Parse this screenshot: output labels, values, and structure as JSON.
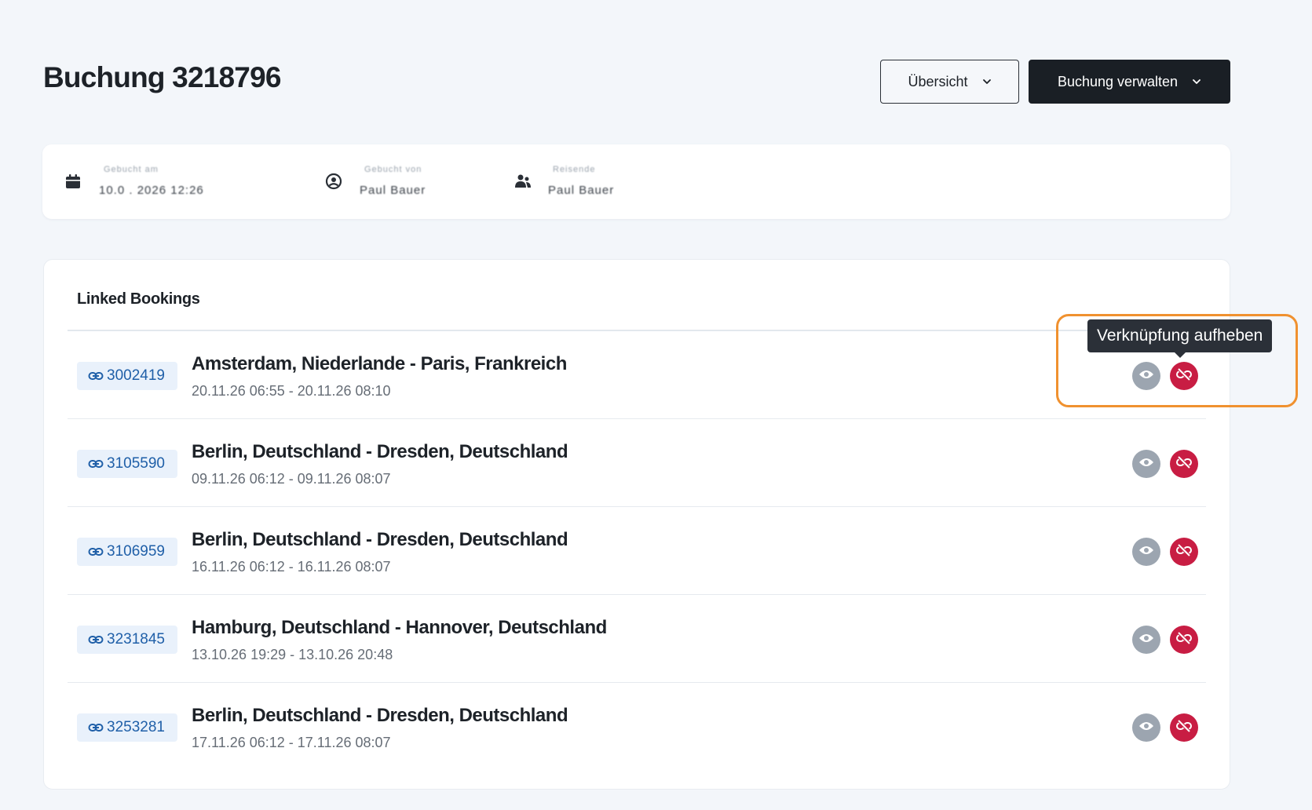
{
  "page": {
    "title": "Buchung 3218796"
  },
  "header": {
    "overview_label": "Übersicht",
    "manage_label": "Buchung verwalten"
  },
  "info": [
    {
      "icon": "calendar-icon",
      "label": "Gebucht am",
      "value": "10.0 . 2026 12:26"
    },
    {
      "icon": "user-circle-icon",
      "label": "Gebucht von",
      "value": "Paul Bauer"
    },
    {
      "icon": "traveller-icon",
      "label": "Reisende",
      "value": "Paul Bauer"
    }
  ],
  "linked": {
    "title": "Linked Bookings",
    "rows": [
      {
        "id": "3002419",
        "route": "Amsterdam, Niederlande - Paris, Frankreich",
        "times": "20.11.26 06:55 - 20.11.26 08:10"
      },
      {
        "id": "3105590",
        "route": "Berlin, Deutschland - Dresden, Deutschland",
        "times": "09.11.26 06:12 - 09.11.26 08:07"
      },
      {
        "id": "3106959",
        "route": "Berlin, Deutschland - Dresden, Deutschland",
        "times": "16.11.26 06:12 - 16.11.26 08:07"
      },
      {
        "id": "3231845",
        "route": "Hamburg, Deutschland - Hannover, Deutschland",
        "times": "13.10.26 19:29 - 13.10.26 20:48"
      },
      {
        "id": "3253281",
        "route": "Berlin, Deutschland - Dresden, Deutschland",
        "times": "17.11.26 06:12 - 17.11.26 08:07"
      }
    ]
  },
  "tooltip": {
    "text": "Verknüpfung aufheben"
  },
  "colors": {
    "background": "#f3f6fa",
    "primary_dark": "#1a1f25",
    "badge_bg": "#e9f1fb",
    "badge_text": "#1f5fa8",
    "unlink_red": "#c81d43",
    "view_grey": "#9ca5b0",
    "highlight_orange": "#f0912f"
  }
}
